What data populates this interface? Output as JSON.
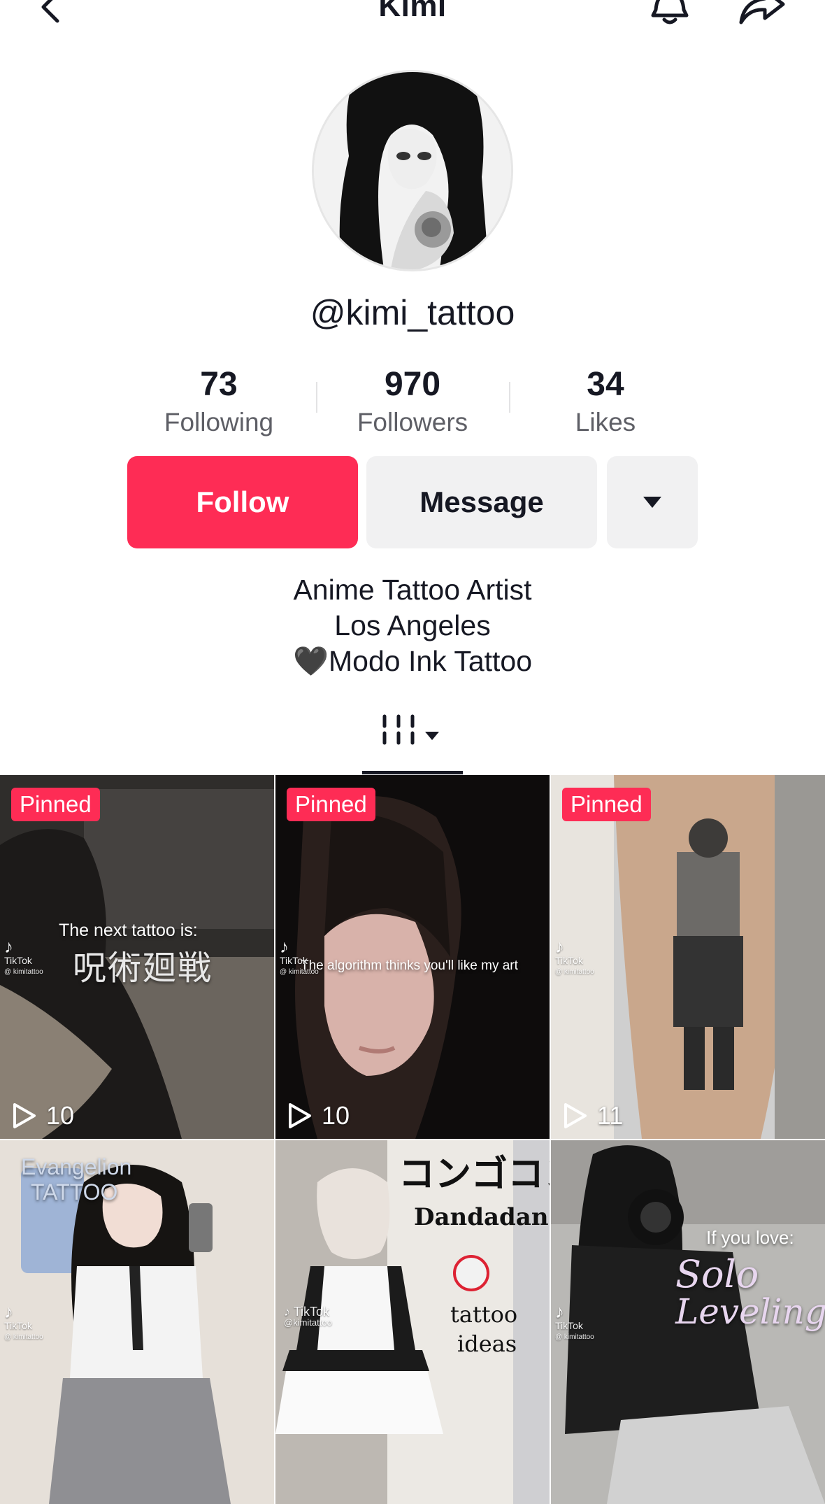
{
  "header": {
    "title": "Kimi",
    "icons": {
      "back": "chevron-left-icon",
      "bell": "bell-icon",
      "share": "share-icon"
    }
  },
  "profile": {
    "username": "@kimi_tattoo",
    "stats": [
      {
        "value": "73",
        "label": "Following"
      },
      {
        "value": "970",
        "label": "Followers"
      },
      {
        "value": "34",
        "label": "Likes"
      }
    ],
    "buttons": {
      "follow": "Follow",
      "message": "Message"
    },
    "bio": [
      "Anime Tattoo Artist",
      "Los Angeles",
      "🖤Modo Ink Tattoo"
    ]
  },
  "colors": {
    "accent": "#fe2c55",
    "secondary_button": "#f1f1f2",
    "text": "#161823",
    "muted": "#5e5f66"
  },
  "videos": [
    {
      "pinned": "Pinned",
      "views": "10",
      "caption": "The next tattoo is:",
      "caption2": "呪術廻戦",
      "watermark": "TikTok",
      "handle": "@ kimitattoo"
    },
    {
      "pinned": "Pinned",
      "views": "10",
      "caption": "The algorithm thinks you'll like my art",
      "watermark": "TikTok",
      "handle": "@ kimitattoo"
    },
    {
      "pinned": "Pinned",
      "views": "11",
      "watermark": "TikTok",
      "handle": "@ kimitattoo"
    },
    {
      "caption": "Evangelion",
      "caption2": "TATTOO",
      "watermark": "TikTok",
      "handle": "@ kimitattoo"
    },
    {
      "caption": "Dandadan",
      "caption2": "tattoo",
      "caption3": "ideas",
      "top_text": "コンゴコン",
      "watermark": "TikTok",
      "handle": "@kimitattoo"
    },
    {
      "caption": "If you love:",
      "caption2": "Solo",
      "caption3": "Leveling",
      "watermark": "TikTok",
      "handle": "@ kimitattoo"
    }
  ]
}
